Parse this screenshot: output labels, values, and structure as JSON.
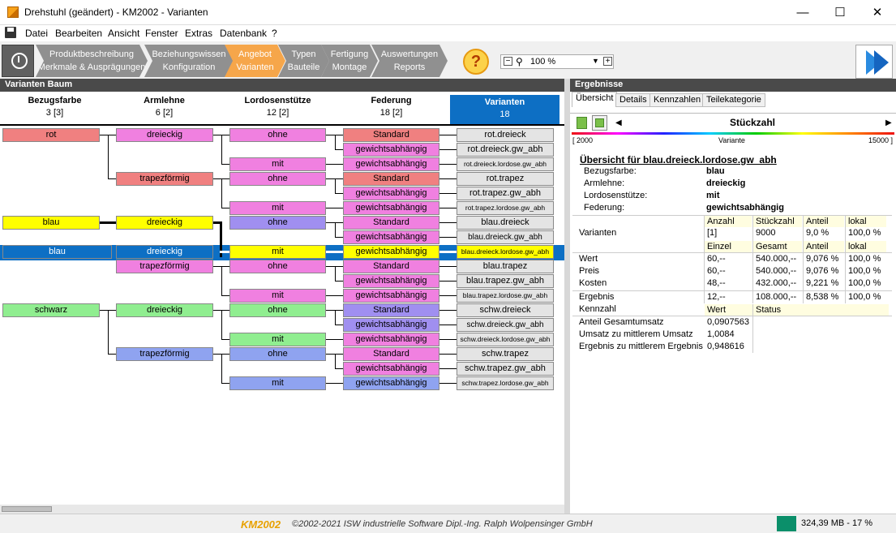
{
  "window": {
    "title": "Drehstuhl (geändert) - KM2002 - Varianten",
    "minimize": "—",
    "maximize": "☐",
    "close": "✕"
  },
  "menu": [
    "Datei",
    "Bearbeiten",
    "Ansicht",
    "Fenster",
    "Extras",
    "Datenbank",
    "?"
  ],
  "steps": [
    {
      "l1": "Produktbeschreibung",
      "l2": "Merkmale & Ausprägungen"
    },
    {
      "l1": "Beziehungswissen",
      "l2": "Konfiguration"
    },
    {
      "l1": "Angebot",
      "l2": "Varianten"
    },
    {
      "l1": "Typen",
      "l2": "Bauteile"
    },
    {
      "l1": "Fertigung",
      "l2": "Montage"
    },
    {
      "l1": "Auswertungen",
      "l2": "Reports"
    }
  ],
  "zoom": {
    "value": "100 %",
    "minus": "−",
    "plus": "+",
    "arrow": "▼"
  },
  "help": "?",
  "icons": {
    "app": "app-icon",
    "save": "save-icon",
    "clock": "clock-icon",
    "next": "fast-forward-icon",
    "help": "help-icon",
    "zoom": "magnifier-icon"
  },
  "left_panel": {
    "title": "Varianten Baum"
  },
  "right_panel": {
    "title": "Ergebnisse"
  },
  "columns": [
    {
      "name": "Bezugsfarbe",
      "count": "3 [3]"
    },
    {
      "name": "Armlehne",
      "count": "6 [2]"
    },
    {
      "name": "Lordosenstütze",
      "count": "12 [2]"
    },
    {
      "name": "Federung",
      "count": "18 [2]"
    },
    {
      "name": "Varianten",
      "count": "18"
    }
  ],
  "tree": {
    "color": [
      {
        "label": "rot",
        "c": "#f08080"
      },
      {
        "label": "blau",
        "c": "#ffff00"
      },
      {
        "label": "blau",
        "c": "#0d6fc4"
      },
      {
        "label": "schwarz",
        "c": "#90ee90"
      }
    ],
    "arm": [
      {
        "label": "dreieckig",
        "c": "#f080e0"
      },
      {
        "label": "trapezförmig",
        "c": "#f08080"
      },
      {
        "label": "dreieckig",
        "c": "#ffff00"
      },
      {
        "label": "dreieckig",
        "c": "#0d6fc4"
      },
      {
        "label": "trapezförmig",
        "c": "#f080e0"
      },
      {
        "label": "dreieckig",
        "c": "#90ee90"
      },
      {
        "label": "trapezförmig",
        "c": "#8fa3f0"
      }
    ],
    "lord": [
      {
        "label": "ohne",
        "c": "#f080e0"
      },
      {
        "label": "mit",
        "c": "#f080e0"
      },
      {
        "label": "ohne",
        "c": "#f080e0"
      },
      {
        "label": "mit",
        "c": "#f080e0"
      },
      {
        "label": "ohne",
        "c": "#a08ff0"
      },
      {
        "label": "mit",
        "c": "#ffff00"
      },
      {
        "label": "ohne",
        "c": "#f080e0"
      },
      {
        "label": "mit",
        "c": "#f080e0"
      },
      {
        "label": "ohne",
        "c": "#90ee90"
      },
      {
        "label": "mit",
        "c": "#90ee90"
      },
      {
        "label": "ohne",
        "c": "#8fa3f0"
      },
      {
        "label": "mit",
        "c": "#8fa3f0"
      }
    ],
    "fed": [
      {
        "label": "Standard",
        "c": "#f08080"
      },
      {
        "label": "gewichtsabhängig",
        "c": "#f080e0"
      },
      {
        "label": "gewichtsabhängig",
        "c": "#f080e0"
      },
      {
        "label": "Standard",
        "c": "#f08080"
      },
      {
        "label": "gewichtsabhängig",
        "c": "#f080e0"
      },
      {
        "label": "gewichtsabhängig",
        "c": "#f080e0"
      },
      {
        "label": "Standard",
        "c": "#f080e0"
      },
      {
        "label": "gewichtsabhängig",
        "c": "#f080e0"
      },
      {
        "label": "gewichtsabhängig",
        "c": "#ffff00"
      },
      {
        "label": "Standard",
        "c": "#f080e0"
      },
      {
        "label": "gewichtsabhängig",
        "c": "#f080e0"
      },
      {
        "label": "gewichtsabhängig",
        "c": "#f080e0"
      },
      {
        "label": "Standard",
        "c": "#a08ff0"
      },
      {
        "label": "gewichtsabhängig",
        "c": "#a08ff0"
      },
      {
        "label": "gewichtsabhängig",
        "c": "#f080e0"
      },
      {
        "label": "Standard",
        "c": "#f080e0"
      },
      {
        "label": "gewichtsabhängig",
        "c": "#f080e0"
      },
      {
        "label": "gewichtsabhängig",
        "c": "#8fa3f0"
      }
    ],
    "variants": [
      "rot.dreieck",
      "rot.dreieck.gw_abh",
      "rot.dreieck.lordose.gw_abh",
      "rot.trapez",
      "rot.trapez.gw_abh",
      "rot.trapez.lordose.gw_abh",
      "blau.dreieck",
      "blau.dreieck.gw_abh",
      "blau.dreieck.lordose.gw_abh",
      "blau.trapez",
      "blau.trapez.gw_abh",
      "blau.trapez.lordose.gw_abh",
      "schw.dreieck",
      "schw.dreieck.gw_abh",
      "schw.dreieck.lordose.gw_abh",
      "schw.trapez",
      "schw.trapez.gw_abh",
      "schw.trapez.lordose.gw_abh"
    ]
  },
  "results": {
    "tabs": [
      "Übersicht",
      "Details",
      "Kennzahlen",
      "Teilekategorie"
    ],
    "metric": "Stückzahl",
    "scale_min": "[ 2000",
    "scale_mid": "Variante",
    "scale_max": "15000 ]",
    "heading": "Übersicht für blau.dreieck.lordose.gw_abh",
    "props": [
      {
        "k": "Bezugsfarbe:",
        "v": "blau"
      },
      {
        "k": "Armlehne:",
        "v": "dreieckig"
      },
      {
        "k": "Lordosenstütze:",
        "v": "mit"
      },
      {
        "k": "Federung:",
        "v": "gewichtsabhängig"
      }
    ],
    "hdr1": [
      "Anzahl",
      "Stückzahl",
      "Anteil",
      "lokal"
    ],
    "row_varianten": [
      "Varianten",
      "[1]",
      "9000",
      "9,0 %",
      "100,0 %"
    ],
    "hdr2": [
      "Einzel",
      "Gesamt",
      "Anteil",
      "lokal"
    ],
    "rows": [
      [
        "Wert",
        "60,--",
        "540.000,--",
        "9,076 %",
        "100,0 %"
      ],
      [
        "Preis",
        "60,--",
        "540.000,--",
        "9,076 %",
        "100,0 %"
      ],
      [
        "Kosten",
        "48,--",
        "432.000,--",
        "9,221 %",
        "100,0 %"
      ]
    ],
    "row_ergebnis": [
      "Ergebnis",
      "12,--",
      "108.000,--",
      "8,538 %",
      "100,0 %"
    ],
    "kennzahl_hdr": [
      "Kennzahl",
      "Wert",
      "Status"
    ],
    "kennzahlen": [
      [
        "Anteil Gesamtumsatz",
        "0,0907563"
      ],
      [
        "Umsatz zu mittlerem Umsatz",
        "1,0084"
      ],
      [
        "Ergebnis zu mittlerem Ergebnis",
        "0,948616"
      ]
    ]
  },
  "status": {
    "brand": "KM2002",
    "copyright": "©2002-2021 ISW industrielle Software Dipl.-Ing. Ralph Wolpensinger GmbH",
    "memory": "324,39 MB - 17 %"
  }
}
